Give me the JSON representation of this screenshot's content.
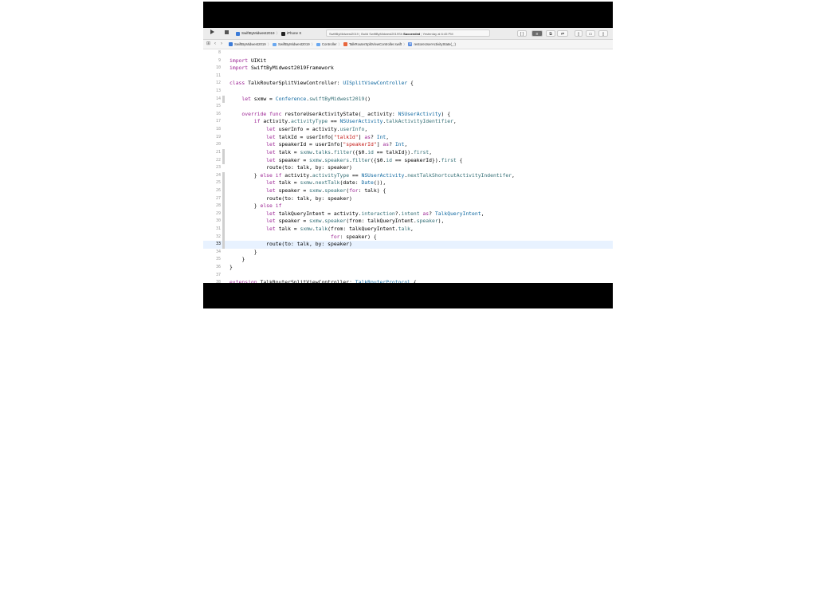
{
  "toolbar": {
    "run_icon": "play-icon",
    "stop_icon": "stop-icon",
    "scheme_label": "SwiftByMidwest2019",
    "device_label": "iPhone X",
    "activity": {
      "project": "SwiftByMidwest2019",
      "build_text": "Build SwiftByMidwest2019Sh",
      "status": "Succeeded",
      "time": "Yesterday at 6:45 PM"
    }
  },
  "jumpbar": {
    "crumbs": [
      {
        "label": "SwiftByMidwest2019",
        "icon": "project-icon"
      },
      {
        "label": "SwiftByMidwest2019",
        "icon": "folder-icon"
      },
      {
        "label": "Controller",
        "icon": "folder-icon"
      },
      {
        "label": "TalkRouterSplitViewController.swift",
        "icon": "swift-file-icon"
      },
      {
        "label": "restoreUserActivityState(_:)",
        "icon": "method-icon"
      }
    ]
  },
  "editor": {
    "active_line": 33,
    "lines": [
      {
        "n": "8",
        "code": ""
      },
      {
        "n": "9",
        "code": "import UIKit"
      },
      {
        "n": "10",
        "code": "import SwiftByMidwest2019Framework"
      },
      {
        "n": "11",
        "code": ""
      },
      {
        "n": "12",
        "code": "class TalkRouterSplitViewController: UISplitViewController {"
      },
      {
        "n": "13",
        "code": ""
      },
      {
        "n": "14",
        "code": "    let sxmw = Conference.swiftByMidwest2019()"
      },
      {
        "n": "15",
        "code": ""
      },
      {
        "n": "16",
        "code": "    override func restoreUserActivityState(_ activity: NSUserActivity) {"
      },
      {
        "n": "17",
        "code": "        if activity.activityType == NSUserActivity.talkActivityIdentifier,"
      },
      {
        "n": "18",
        "code": "            let userInfo = activity.userInfo,"
      },
      {
        "n": "19",
        "code": "            let talkId = userInfo[\"talkId\"] as? Int,"
      },
      {
        "n": "20",
        "code": "            let speakerId = userInfo[\"speakerId\"] as? Int,"
      },
      {
        "n": "21",
        "code": "            let talk = sxmw.talks.filter({$0.id == talkId}).first,"
      },
      {
        "n": "22",
        "code": "            let speaker = sxmw.speakers.filter({$0.id == speakerId}).first {"
      },
      {
        "n": "23",
        "code": "            route(to: talk, by: speaker)"
      },
      {
        "n": "24",
        "code": "        } else if activity.activityType == NSUserActivity.nextTalkShortcutActivityIndentifer,"
      },
      {
        "n": "25",
        "code": "            let talk = sxmw.nextTalk(date: Date()),"
      },
      {
        "n": "26",
        "code": "            let speaker = sxmw.speaker(for: talk) {"
      },
      {
        "n": "27",
        "code": "            route(to: talk, by: speaker)"
      },
      {
        "n": "28",
        "code": "        } else if"
      },
      {
        "n": "29",
        "code": "            let talkQueryIntent = activity.interaction?.intent as? TalkQueryIntent,"
      },
      {
        "n": "30",
        "code": "            let speaker = sxmw.speaker(from: talkQueryIntent.speaker),"
      },
      {
        "n": "31",
        "code": "            let talk = sxmw.talk(from: talkQueryIntent.talk,"
      },
      {
        "n": "32",
        "code": "                                 for: speaker) {"
      },
      {
        "n": "33",
        "code": "            route(to: talk, by: speaker)"
      },
      {
        "n": "34",
        "code": "        }"
      },
      {
        "n": "35",
        "code": "    }"
      },
      {
        "n": "36",
        "code": "}"
      },
      {
        "n": "37",
        "code": ""
      },
      {
        "n": "38",
        "code": "extension TalkRouterSplitViewController: TalkRouterProtocol {"
      }
    ]
  },
  "colors": {
    "keyword": "#9b2393",
    "type": "#0f68a0",
    "member": "#326d74",
    "string": "#c41a16",
    "active_line_bg": "#e8f2ff"
  }
}
